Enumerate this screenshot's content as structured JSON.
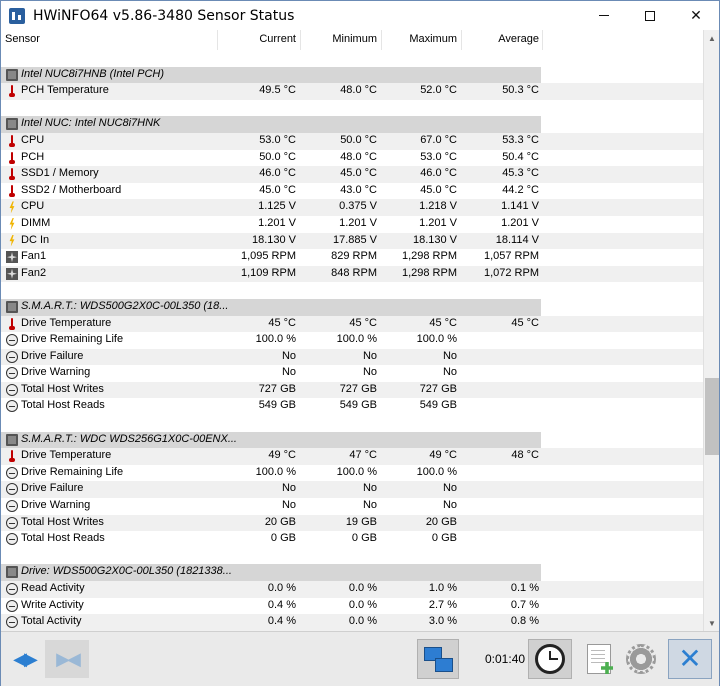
{
  "window": {
    "title": "HWiNFO64 v5.86-3480 Sensor Status"
  },
  "columns": {
    "sensor": "Sensor",
    "current": "Current",
    "minimum": "Minimum",
    "maximum": "Maximum",
    "average": "Average"
  },
  "rows": [
    {
      "type": "blank"
    },
    {
      "type": "group",
      "name": "Intel NUC8i7HNB (Intel PCH)"
    },
    {
      "type": "data",
      "icon": "thermometer-icon",
      "name": "PCH Temperature",
      "cur": "49.5 °C",
      "min": "48.0 °C",
      "max": "52.0 °C",
      "avg": "50.3 °C"
    },
    {
      "type": "blank"
    },
    {
      "type": "group",
      "name": "Intel NUC: Intel NUC8i7HNK"
    },
    {
      "type": "data",
      "icon": "thermometer-icon",
      "name": "CPU",
      "cur": "53.0 °C",
      "min": "50.0 °C",
      "max": "67.0 °C",
      "avg": "53.3 °C"
    },
    {
      "type": "data",
      "icon": "thermometer-icon",
      "name": "PCH",
      "cur": "50.0 °C",
      "min": "48.0 °C",
      "max": "53.0 °C",
      "avg": "50.4 °C"
    },
    {
      "type": "data",
      "icon": "thermometer-icon",
      "name": "SSD1 / Memory",
      "cur": "46.0 °C",
      "min": "45.0 °C",
      "max": "46.0 °C",
      "avg": "45.3 °C"
    },
    {
      "type": "data",
      "icon": "thermometer-icon",
      "name": "SSD2 / Motherboard",
      "cur": "45.0 °C",
      "min": "43.0 °C",
      "max": "45.0 °C",
      "avg": "44.2 °C"
    },
    {
      "type": "data",
      "icon": "voltage-icon",
      "name": "CPU",
      "cur": "1.125 V",
      "min": "0.375 V",
      "max": "1.218 V",
      "avg": "1.141 V"
    },
    {
      "type": "data",
      "icon": "voltage-icon",
      "name": "DIMM",
      "cur": "1.201 V",
      "min": "1.201 V",
      "max": "1.201 V",
      "avg": "1.201 V"
    },
    {
      "type": "data",
      "icon": "voltage-icon",
      "name": "DC In",
      "cur": "18.130 V",
      "min": "17.885 V",
      "max": "18.130 V",
      "avg": "18.114 V"
    },
    {
      "type": "data",
      "icon": "fan-icon",
      "name": "Fan1",
      "cur": "1,095 RPM",
      "min": "829 RPM",
      "max": "1,298 RPM",
      "avg": "1,057 RPM"
    },
    {
      "type": "data",
      "icon": "fan-icon",
      "name": "Fan2",
      "cur": "1,109 RPM",
      "min": "848 RPM",
      "max": "1,298 RPM",
      "avg": "1,072 RPM"
    },
    {
      "type": "blank"
    },
    {
      "type": "group",
      "name": "S.M.A.R.T.: WDS500G2X0C-00L350 (18..."
    },
    {
      "type": "data",
      "icon": "thermometer-icon",
      "name": "Drive Temperature",
      "cur": "45 °C",
      "min": "45 °C",
      "max": "45 °C",
      "avg": "45 °C"
    },
    {
      "type": "data",
      "icon": "gauge-icon",
      "name": "Drive Remaining Life",
      "cur": "100.0 %",
      "min": "100.0 %",
      "max": "100.0 %",
      "avg": ""
    },
    {
      "type": "data",
      "icon": "gauge-icon",
      "name": "Drive Failure",
      "cur": "No",
      "min": "No",
      "max": "No",
      "avg": ""
    },
    {
      "type": "data",
      "icon": "gauge-icon",
      "name": "Drive Warning",
      "cur": "No",
      "min": "No",
      "max": "No",
      "avg": ""
    },
    {
      "type": "data",
      "icon": "gauge-icon",
      "name": "Total Host Writes",
      "cur": "727 GB",
      "min": "727 GB",
      "max": "727 GB",
      "avg": ""
    },
    {
      "type": "data",
      "icon": "gauge-icon",
      "name": "Total Host Reads",
      "cur": "549 GB",
      "min": "549 GB",
      "max": "549 GB",
      "avg": ""
    },
    {
      "type": "blank"
    },
    {
      "type": "group",
      "name": "S.M.A.R.T.: WDC WDS256G1X0C-00ENX..."
    },
    {
      "type": "data",
      "icon": "thermometer-icon",
      "name": "Drive Temperature",
      "cur": "49 °C",
      "min": "47 °C",
      "max": "49 °C",
      "avg": "48 °C"
    },
    {
      "type": "data",
      "icon": "gauge-icon",
      "name": "Drive Remaining Life",
      "cur": "100.0 %",
      "min": "100.0 %",
      "max": "100.0 %",
      "avg": ""
    },
    {
      "type": "data",
      "icon": "gauge-icon",
      "name": "Drive Failure",
      "cur": "No",
      "min": "No",
      "max": "No",
      "avg": ""
    },
    {
      "type": "data",
      "icon": "gauge-icon",
      "name": "Drive Warning",
      "cur": "No",
      "min": "No",
      "max": "No",
      "avg": ""
    },
    {
      "type": "data",
      "icon": "gauge-icon",
      "name": "Total Host Writes",
      "cur": "20 GB",
      "min": "19 GB",
      "max": "20 GB",
      "avg": ""
    },
    {
      "type": "data",
      "icon": "gauge-icon",
      "name": "Total Host Reads",
      "cur": "0 GB",
      "min": "0 GB",
      "max": "0 GB",
      "avg": ""
    },
    {
      "type": "blank"
    },
    {
      "type": "group",
      "name": "Drive: WDS500G2X0C-00L350 (1821338..."
    },
    {
      "type": "data",
      "icon": "gauge-icon",
      "name": "Read Activity",
      "cur": "0.0 %",
      "min": "0.0 %",
      "max": "1.0 %",
      "avg": "0.1 %"
    },
    {
      "type": "data",
      "icon": "gauge-icon",
      "name": "Write Activity",
      "cur": "0.4 %",
      "min": "0.0 %",
      "max": "2.7 %",
      "avg": "0.7 %"
    },
    {
      "type": "data",
      "icon": "gauge-icon",
      "name": "Total Activity",
      "cur": "0.4 %",
      "min": "0.0 %",
      "max": "3.0 %",
      "avg": "0.8 %"
    }
  ],
  "toolbar": {
    "timer": "0:01:40"
  }
}
